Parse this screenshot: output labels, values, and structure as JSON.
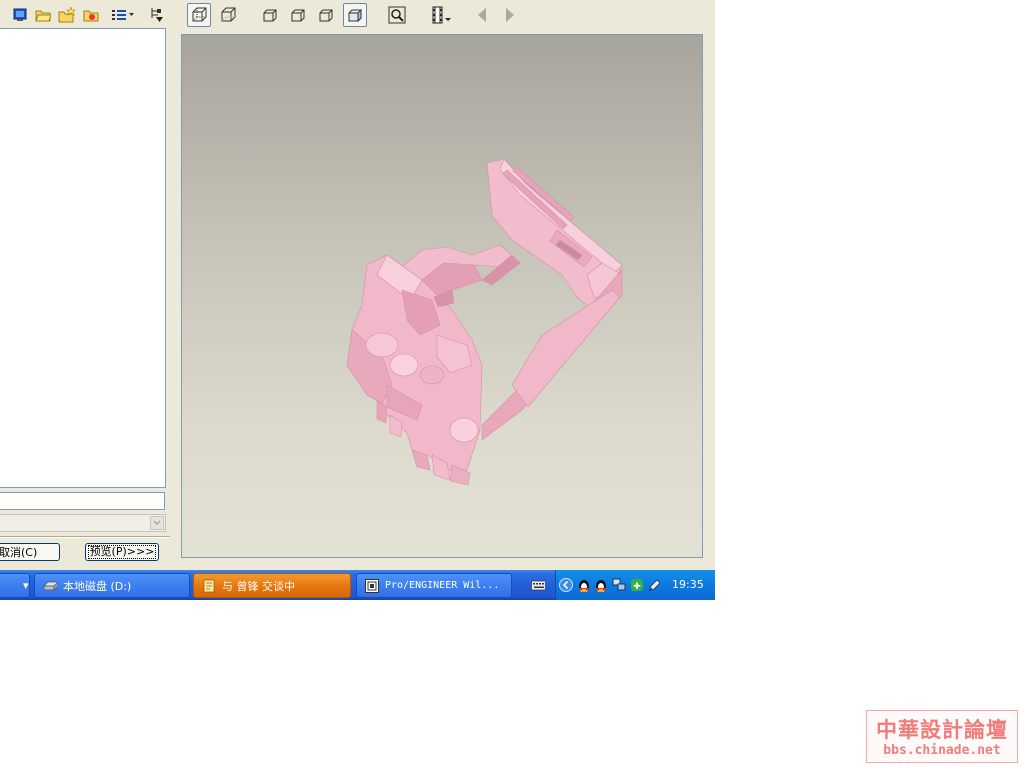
{
  "toolbar": {
    "left_icons": [
      "monitor-icon",
      "open-folder-icon",
      "new-folder-icon",
      "favorites-folder-icon",
      "list-view-icon",
      "tree-filter-icon"
    ],
    "view_icons": [
      "wireframe-view-icon",
      "hidden-line-view-icon",
      "no-hidden-view-icon",
      "shading-view-icon",
      "hidden-edges-view-icon",
      "shaded-model-icon",
      "zoom-icon",
      "film-strip-icon",
      "back-arrow-icon",
      "forward-arrow-icon"
    ]
  },
  "dialog": {
    "name_value": "",
    "type_value": "",
    "cancel_label": "取消(C)",
    "preview_label": "预览(P)>>>"
  },
  "viewport": {
    "background_top": "#a7a49c",
    "background_bottom": "#e3e1d3",
    "model_color": "#f0b8c8"
  },
  "taskbar": {
    "tasks": [
      {
        "label": "本地磁盘 (D:)",
        "icon": "drive-icon",
        "state": "normal"
      },
      {
        "label": "与 曾锋 交谈中",
        "icon": "chat-note-icon",
        "state": "flashing"
      },
      {
        "label": "Pro/ENGINEER Wil...",
        "icon": "proe-window-icon",
        "state": "normal"
      }
    ],
    "tray_icons": [
      "keyboard-icon",
      "collapse-arrow-icon",
      "qq-penguin-icon",
      "qq-penguin-icon",
      "network-icon",
      "antivirus-icon",
      "speaker-icon"
    ],
    "clock": "19:35",
    "color": "#245edb"
  },
  "watermark": {
    "title": "中華設計論壇",
    "url": "bbs.chinade.net",
    "color": "#f07c7c"
  }
}
